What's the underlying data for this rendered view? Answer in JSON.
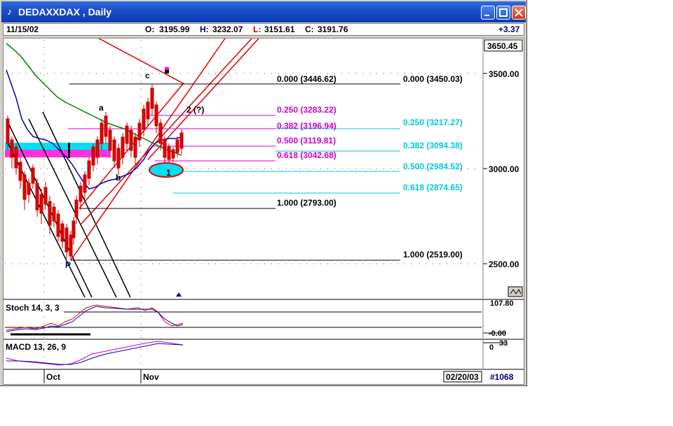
{
  "window": {
    "title": "DEDAXXDAX , Daily",
    "app_icon": "chart-app-icon"
  },
  "infobar": {
    "date": "11/15/02",
    "open_label": "O:",
    "open": "3195.99",
    "high_label": "H:",
    "high": "3232.07",
    "low_label": "L:",
    "low": "3151.61",
    "close_label": "C:",
    "close": "3191.76",
    "change": "+3.37"
  },
  "price_axis": {
    "top_value": "3650.45",
    "ticks": [
      "3500.00",
      "3000.00",
      "2500.00"
    ]
  },
  "fib_left": {
    "levels": [
      "0.000 (3446.62)",
      "0.250 (3283.22)",
      "0.382 (3196.94)",
      "0.500 (3119.81)",
      "0.618 (3042.68)",
      "1.000 (2793.00)"
    ]
  },
  "fib_right": {
    "levels": [
      "0.000 (3450.03)",
      "0.250 (3217.27)",
      "0.382 (3094.38)",
      "0.500 (2984.52)",
      "0.618 (2874.65)",
      "1.000 (2519.00)"
    ]
  },
  "wave_labels": {
    "a": "a",
    "b": "b",
    "c": "c",
    "two": "2 (?)",
    "one": "1",
    "p": "P"
  },
  "stoch": {
    "label": "Stoch 14, 3, 3",
    "axis_top": "107.80",
    "axis_bottom": "-0.00"
  },
  "macd": {
    "label": "MACD 13, 26, 9",
    "axis_top": "33",
    "axis_mid": "0"
  },
  "date_axis": {
    "labels": [
      "Oct",
      "Nov"
    ],
    "end_date": "02/20/03",
    "bar_count": "#1068"
  },
  "colors": {
    "bull_candle": "#d00000",
    "fib_left": "#cc00cc",
    "fib_right": "#00c8d8",
    "ma_blue": "#0000b0",
    "ma_green": "#008000",
    "channel_red": "#e00000"
  }
}
